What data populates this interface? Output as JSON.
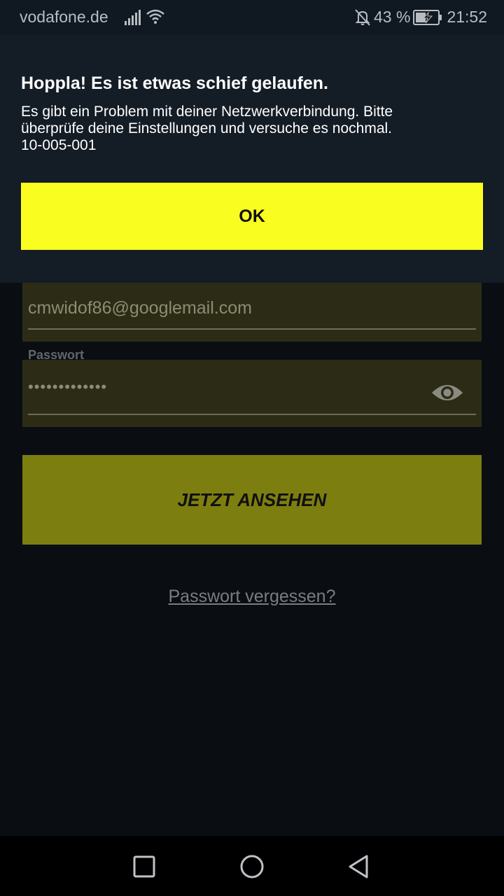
{
  "status_bar": {
    "carrier": "vodafone.de",
    "battery_percent": "43 %",
    "time": "21:52",
    "icons": [
      "signal-icon",
      "wifi-icon",
      "notifications-muted-icon",
      "battery-charging-icon"
    ]
  },
  "dialog": {
    "title": "Hoppla! Es ist etwas schief gelaufen.",
    "message_lines": [
      "Es gibt ein Problem mit deiner Netzwerkverbindung. Bitte",
      "überprüfe deine Einstellungen und versuche es nochmal.",
      "10-005-001"
    ],
    "ok_label": "OK"
  },
  "login": {
    "email_value": "cmwidof86@googlemail.com",
    "password_label": "Passwort",
    "password_value": "•••••••••••••",
    "watch_button_label": "JETZT ANSEHEN",
    "forgot_password_label": "Passwort vergessen?"
  },
  "nav_bar": {
    "buttons": [
      "recents-icon",
      "home-icon",
      "back-icon"
    ]
  },
  "colors": {
    "accent_yellow": "#fafd20",
    "dimmed_button": "#7d7e10",
    "dialog_background": "#141c26",
    "screen_background": "#0a0e13"
  }
}
